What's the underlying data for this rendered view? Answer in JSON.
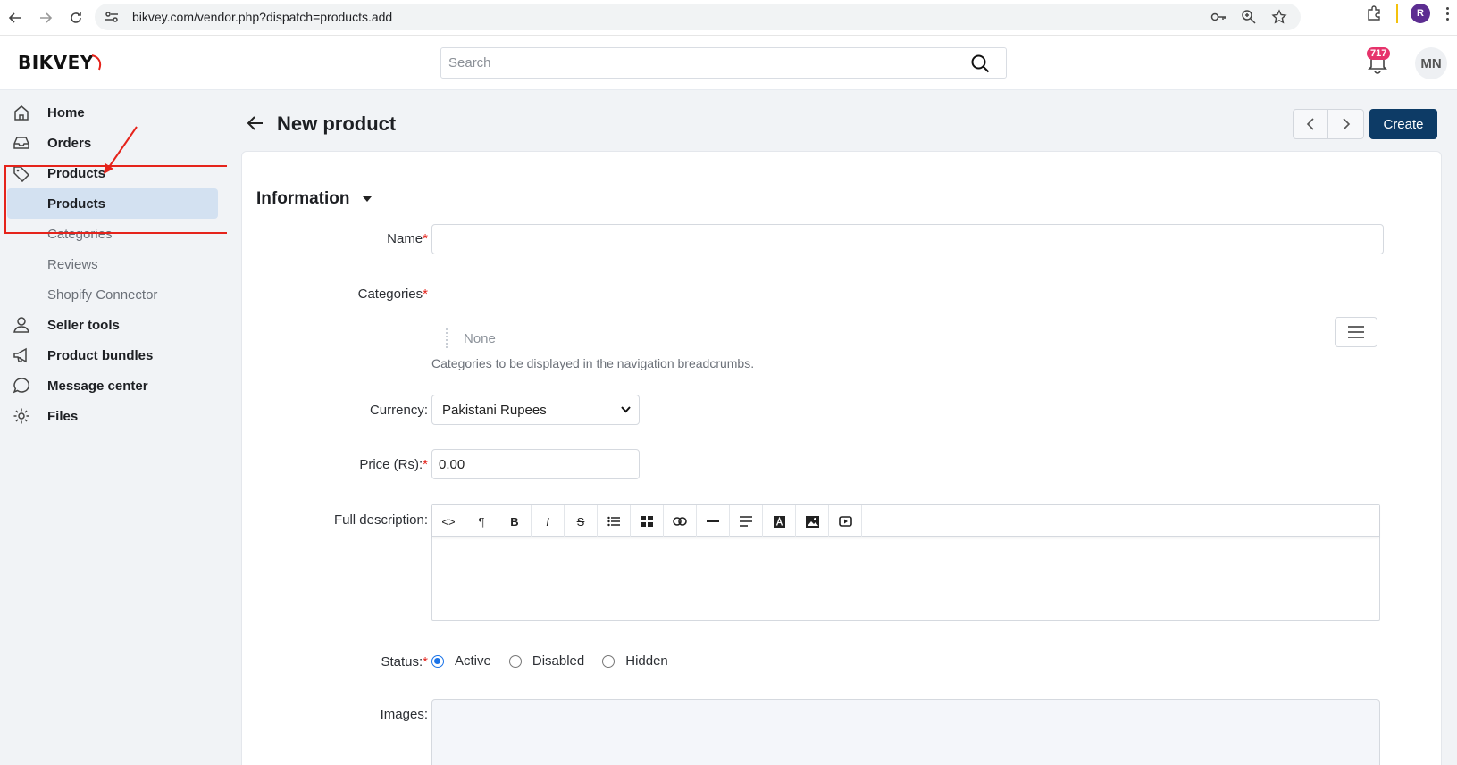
{
  "browser": {
    "url": "bikvey.com/vendor.php?dispatch=products.add",
    "profile_initial": "R"
  },
  "header": {
    "logo": "BIKVEY",
    "search_placeholder": "Search",
    "notification_count": "717",
    "avatar_initials": "MN"
  },
  "sidebar": {
    "items": [
      {
        "label": "Home",
        "icon": "home-icon"
      },
      {
        "label": "Orders",
        "icon": "inbox-icon"
      },
      {
        "label": "Products",
        "icon": "tag-icon"
      },
      {
        "label": "Products",
        "icon": "",
        "active": true
      },
      {
        "label": "Categories",
        "icon": ""
      },
      {
        "label": "Reviews",
        "icon": ""
      },
      {
        "label": "Shopify Connector",
        "icon": ""
      },
      {
        "label": "Seller tools",
        "icon": "user-icon"
      },
      {
        "label": "Product bundles",
        "icon": "megaphone-icon"
      },
      {
        "label": "Message center",
        "icon": "chat-icon"
      },
      {
        "label": "Files",
        "icon": "gear-icon"
      }
    ]
  },
  "page": {
    "title": "New product",
    "create_label": "Create",
    "section_title": "Information"
  },
  "form": {
    "name_label": "Name",
    "name_value": "",
    "categories_label": "Categories",
    "categories_value": "None",
    "categories_hint": "Categories to be displayed in the navigation breadcrumbs.",
    "currency_label": "Currency:",
    "currency_value": "Pakistani Rupees",
    "price_label": "Price (Rs):",
    "price_value": "0.00",
    "description_label": "Full description:",
    "status_label": "Status:",
    "status_options": [
      "Active",
      "Disabled",
      "Hidden"
    ],
    "status_selected": "Active",
    "images_label": "Images:",
    "required_mark": "*"
  },
  "colors": {
    "primary": "#0d3b66",
    "highlight": "#e5231b",
    "badge": "#e6336b",
    "active_bg": "#d3e1f1"
  }
}
